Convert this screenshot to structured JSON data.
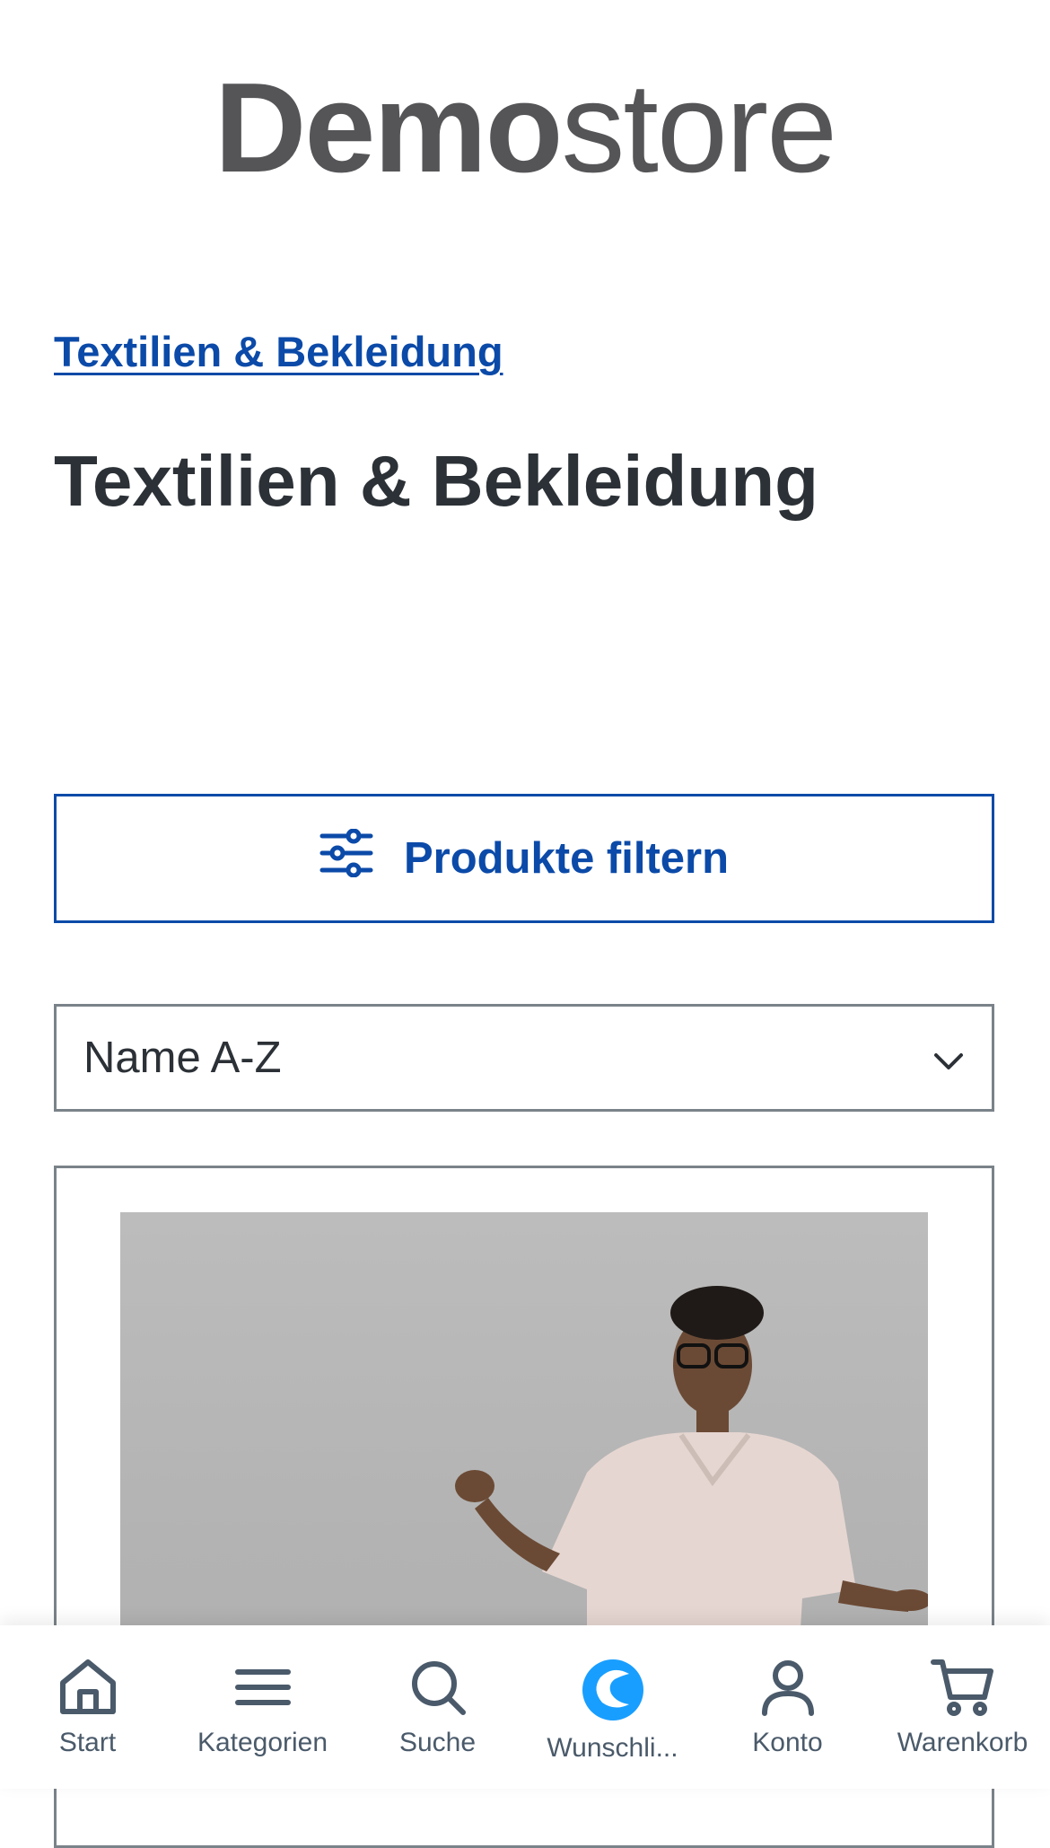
{
  "logo": {
    "bold_part": "Demo",
    "light_part": "store"
  },
  "breadcrumb": {
    "label": "Textilien & Bekleidung"
  },
  "page": {
    "title": "Textilien & Bekleidung"
  },
  "filter": {
    "label": "Produkte filtern",
    "icon": "sliders-icon"
  },
  "sort": {
    "selected": "Name A-Z",
    "icon": "chevron-down-icon"
  },
  "product": {
    "image_description_icon": "product-photo"
  },
  "bottom_nav": {
    "items": [
      {
        "label": "Start",
        "icon": "home-icon"
      },
      {
        "label": "Kategorien",
        "icon": "menu-icon"
      },
      {
        "label": "Suche",
        "icon": "search-icon"
      },
      {
        "label": "Wunschli...",
        "icon": "wishlist-logo-icon"
      },
      {
        "label": "Konto",
        "icon": "user-icon"
      },
      {
        "label": "Warenkorb",
        "icon": "cart-icon"
      }
    ]
  },
  "colors": {
    "brand_blue": "#0b4aa8",
    "text_dark": "#2b3136",
    "nav_text": "#4a5a6a",
    "wishlist_accent": "#189eff"
  }
}
